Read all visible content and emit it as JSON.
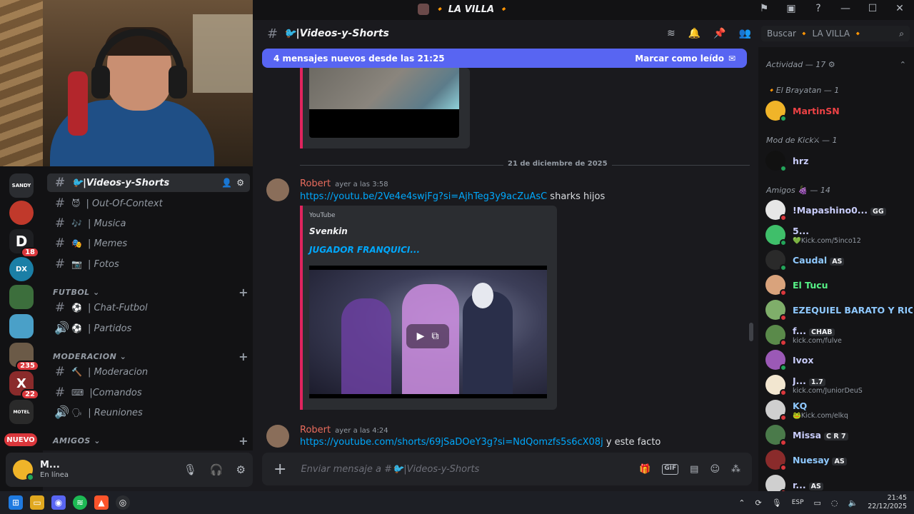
{
  "window": {
    "server_title": "🔸 LA VILLA 🔸",
    "icons": [
      "flag-icon",
      "monitor-icon",
      "help-icon",
      "minimize-icon",
      "maximize-icon",
      "close-icon"
    ],
    "controls": [
      "?",
      "—",
      "☐",
      "✕"
    ]
  },
  "header": {
    "channel_name": "🐦|Videos-y-Shorts",
    "icons": [
      "threads-icon",
      "bell-icon",
      "pin-icon",
      "members-icon"
    ]
  },
  "search": {
    "placeholder": "Buscar 🔸 LA VILLA 🔸"
  },
  "new_messages_bar": {
    "text": "4 mensajes nuevos desde las 21:25",
    "mark_read": "Marcar como leído"
  },
  "server_rail": {
    "servers": [
      {
        "label": "SANDY",
        "color": "#2b2d31",
        "badge": ""
      },
      {
        "label": "",
        "color": "#c0392b",
        "badge": ""
      },
      {
        "label": "D",
        "color": "#1e1f22",
        "badge": "18"
      },
      {
        "label": "DX",
        "color": "#1b7fa6",
        "badge": ""
      },
      {
        "label": "",
        "color": "#3c6e3c",
        "badge": ""
      },
      {
        "label": "",
        "color": "#4aa0c8",
        "badge": ""
      },
      {
        "label": "",
        "color": "#6b5a47",
        "badge": "235"
      },
      {
        "label": "X",
        "color": "#8a2b2b",
        "badge": "22"
      },
      {
        "label": "MOTEL",
        "color": "#2a2a2a",
        "badge": ""
      }
    ],
    "new_label": "NUEVO"
  },
  "channels": {
    "active": "🐦|Videos-y-Shorts",
    "items": [
      {
        "type": "text",
        "emoji": "😈",
        "name": "| Out-Of-Context"
      },
      {
        "type": "text",
        "emoji": "🎶",
        "name": "| Musica"
      },
      {
        "type": "text",
        "emoji": "🎭",
        "name": "| Memes"
      },
      {
        "type": "text",
        "emoji": "📷",
        "name": "| Fotos"
      }
    ],
    "cat_futbol": "FUTBOL",
    "futbol": [
      {
        "type": "text",
        "emoji": "⚽",
        "name": "| Chat-Futbol"
      },
      {
        "type": "voice",
        "emoji": "⚽",
        "name": "| Partidos"
      }
    ],
    "cat_moderacion": "MODERACION",
    "moderacion": [
      {
        "type": "text",
        "emoji": "🔨",
        "name": "| Moderacion"
      },
      {
        "type": "text",
        "emoji": "⌨",
        "name": "|Comandos"
      },
      {
        "type": "voice",
        "emoji": "🗣",
        "name": "| Reuniones"
      }
    ],
    "cat_amigos": "AMIGOS"
  },
  "user_panel": {
    "name": "M...",
    "status": "En línea"
  },
  "messages": {
    "date_divider": "21 de diciembre de 2025",
    "msg1": {
      "author": "Robert",
      "time": "ayer a las 3:58",
      "link": "https://youtu.be/2Ve4e4swjFg?si=AjhTeg3y9acZuAsC",
      "text": " sharks hijos",
      "embed": {
        "provider": "YouTube",
        "author": "Svenkin",
        "title": "JUGADOR FRANQUICI..."
      }
    },
    "msg2": {
      "author": "Robert",
      "time": "ayer a las 4:24",
      "link": "https://youtube.com/shorts/69jSaDOeY3g?si=NdQomzfs5s6cX08j",
      "text": " y este facto"
    }
  },
  "composer": {
    "placeholder": "Enviar mensaje a #🐦|Videos-y-Shorts",
    "gif": "GIF"
  },
  "members": {
    "activity_header": "Actividad — 17",
    "role1": "🔸El Brayatan — 1",
    "role1_members": [
      {
        "name": "MartinSN",
        "color": "#ed4245",
        "avatar": "#f0b429",
        "status": "#23a55a",
        "sub": "",
        "tag": ""
      }
    ],
    "role2": "Mod de Kick⚔ — 1",
    "role2_members": [
      {
        "name": "hrz",
        "color": "#c9cdfb",
        "avatar": "#111111",
        "status": "#23a55a",
        "sub": "",
        "tag": ""
      }
    ],
    "role3": "Amigos 🍇 — 14",
    "role3_members": [
      {
        "name": "!Mapashino0...",
        "color": "#c9cdfb",
        "avatar": "#e6e6e6",
        "status": "#da373c",
        "sub": "",
        "tag": "GG"
      },
      {
        "name": "5...",
        "color": "#c9cdfb",
        "avatar": "#3fbf6a",
        "status": "#23a55a",
        "sub": "💚Kick.com/5inco12",
        "tag": ""
      },
      {
        "name": "Caudal",
        "color": "#8fc9ff",
        "avatar": "#2a2a2a",
        "status": "#23a55a",
        "sub": "",
        "tag": "AS"
      },
      {
        "name": "El Tucu",
        "color": "#57f287",
        "avatar": "#d9a37c",
        "status": "#da373c",
        "sub": "",
        "tag": ""
      },
      {
        "name": "EZEQUIEL BARATO Y RICO",
        "color": "#8fc9ff",
        "avatar": "#7fae6a",
        "status": "#da373c",
        "sub": "",
        "tag": ""
      },
      {
        "name": "f...",
        "color": "#c9cdfb",
        "avatar": "#5a8a4a",
        "status": "#da373c",
        "sub": "kick.com/fulve",
        "tag": "CHAB"
      },
      {
        "name": "Ivox",
        "color": "#c9cdfb",
        "avatar": "#9b59b6",
        "status": "#23a55a",
        "sub": "",
        "tag": ""
      },
      {
        "name": "J...",
        "color": "#c9cdfb",
        "avatar": "#f2e6d0",
        "status": "#da373c",
        "sub": "kick.com/JuniorDeuS",
        "tag": "1.7"
      },
      {
        "name": "KQ",
        "color": "#8fc9ff",
        "avatar": "#cfcfcf",
        "status": "#da373c",
        "sub": "🐸Kick.com/elkq",
        "tag": ""
      },
      {
        "name": "Missa",
        "color": "#c9cdfb",
        "avatar": "#4a7a4a",
        "status": "#da373c",
        "sub": "",
        "tag": "C R 7"
      },
      {
        "name": "Nuesay",
        "color": "#8fc9ff",
        "avatar": "#8a2b2b",
        "status": "#da373c",
        "sub": "",
        "tag": "AS"
      },
      {
        "name": "r...",
        "color": "#c9cdfb",
        "avatar": "#cfcfcf",
        "status": "#da373c",
        "sub": "",
        "tag": "AS"
      }
    ]
  },
  "taskbar": {
    "apps": [
      "windows-icon",
      "explorer-icon",
      "discord-icon",
      "spotify-icon",
      "brave-icon",
      "obs-icon"
    ],
    "lang": "ESP",
    "time": "21:45",
    "date": "22/12/2025"
  }
}
